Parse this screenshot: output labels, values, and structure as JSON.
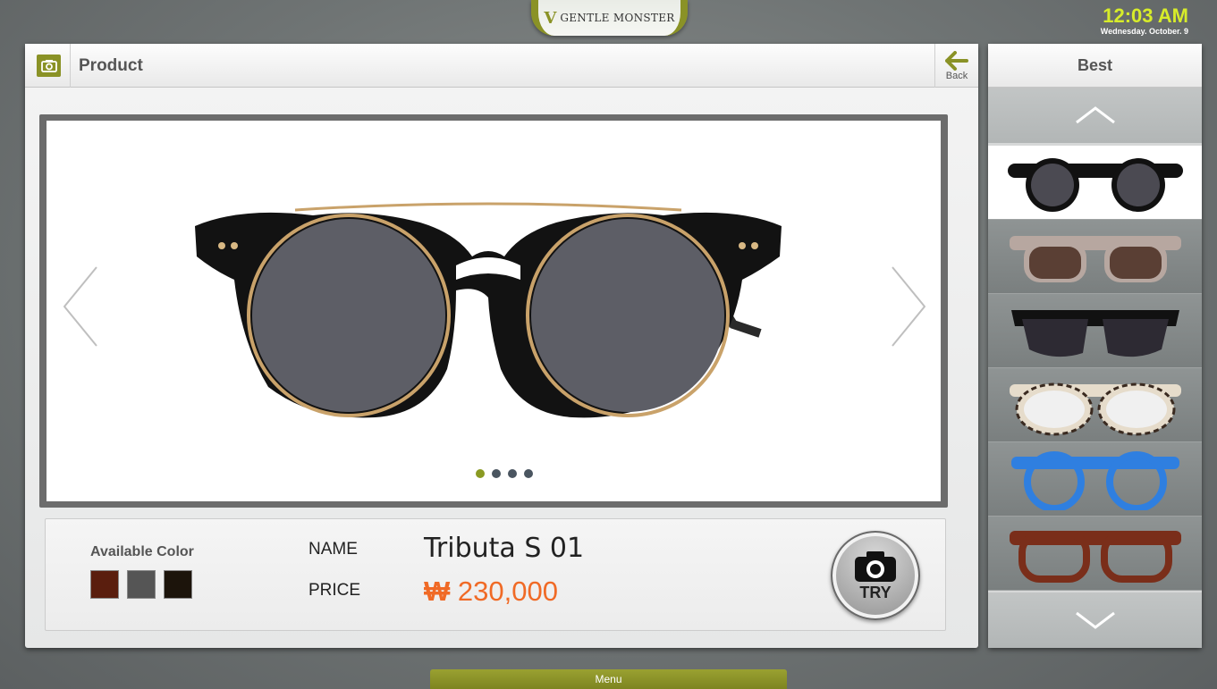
{
  "brand": {
    "logo_mark": "V",
    "name": "GENTLE MONSTER"
  },
  "clock": {
    "time": "12:03 AM",
    "date": "Wednesday. October. 9"
  },
  "header": {
    "title": "Product",
    "back_label": "Back",
    "camera_icon": "camera-icon",
    "back_icon": "back-arrow-icon"
  },
  "gallery": {
    "page_count": 4,
    "active_page": 1
  },
  "product": {
    "available_color_label": "Available Color",
    "colors": [
      "#5a1e0e",
      "#555555",
      "#1c140b"
    ],
    "name_label": "NAME",
    "name": "Tributa S 01",
    "price_label": "PRICE",
    "currency": "₩",
    "price": "230,000",
    "try_label": "TRY",
    "accent_color": "#f06a26"
  },
  "best": {
    "title": "Best",
    "items": [
      {
        "style": "black round clip-on sunglasses"
      },
      {
        "style": "grey beige sunglasses"
      },
      {
        "style": "black half-rim sunglasses"
      },
      {
        "style": "tortoise cream glasses"
      },
      {
        "style": "blue round glasses"
      },
      {
        "style": "brown tortoise glasses"
      }
    ]
  },
  "menu": {
    "label": "Menu"
  },
  "colors": {
    "accent": "#8a9226",
    "clock": "#d7ec2a"
  }
}
